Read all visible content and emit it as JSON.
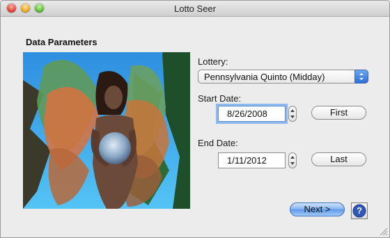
{
  "window": {
    "title": "Lotto Seer"
  },
  "section": {
    "title": "Data Parameters"
  },
  "lottery": {
    "label": "Lottery:",
    "selected": "Pennsylvania Quinto (Midday)"
  },
  "start_date": {
    "label": "Start Date:",
    "value": "8/26/2008",
    "button": "First"
  },
  "end_date": {
    "label": "End Date:",
    "value": "1/11/2012",
    "button": "Last"
  },
  "footer": {
    "next_label": "Next >",
    "help_glyph": "?"
  },
  "colors": {
    "accent": "#5a97ea",
    "art_sky": "#3aa7e8"
  },
  "icons": [
    "close-icon",
    "minimize-icon",
    "zoom-icon",
    "popup-arrows-icon",
    "stepper-icon",
    "help-icon",
    "resize-grip-icon"
  ]
}
